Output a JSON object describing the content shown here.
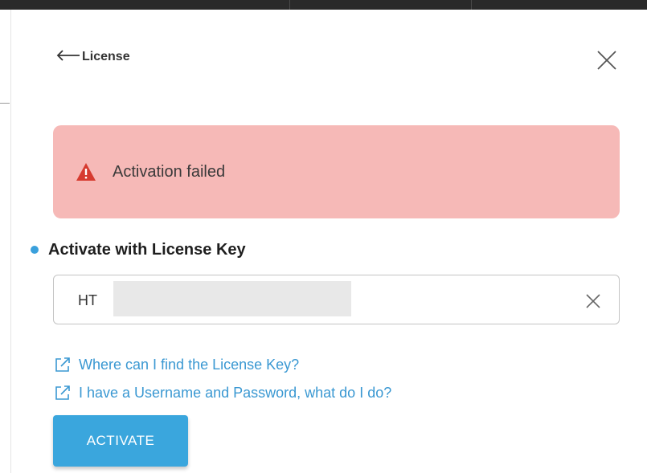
{
  "header": {
    "back_label": "License",
    "back_icon": "arrow-left-icon",
    "close_icon": "close-icon"
  },
  "alert": {
    "message": "Activation failed",
    "icon": "warning-triangle-icon",
    "background_color": "#f6b9b7",
    "icon_color": "#d63a2f"
  },
  "license_key": {
    "section_label": "Activate with License Key",
    "input_value": "HT",
    "clear_icon": "clear-icon",
    "accent_color": "#3aa0dc"
  },
  "help_links": [
    {
      "label": "Where can I find the License Key?",
      "icon": "external-link-icon"
    },
    {
      "label": "I have a Username and Password, what do I do?",
      "icon": "external-link-icon"
    }
  ],
  "actions": {
    "activate_label": "ACTIVATE",
    "button_color": "#3aa6dd"
  }
}
